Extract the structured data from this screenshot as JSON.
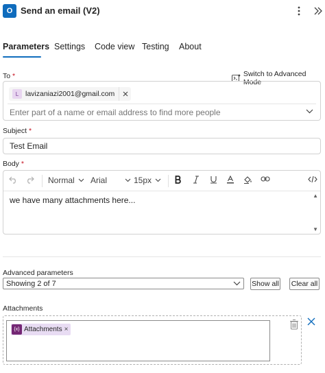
{
  "header": {
    "title": "Send an email (V2)",
    "app_icon_letter": "O"
  },
  "tabs": [
    {
      "label": "Parameters",
      "active": true
    },
    {
      "label": "Settings"
    },
    {
      "label": "Code view"
    },
    {
      "label": "Testing"
    },
    {
      "label": "About"
    }
  ],
  "to": {
    "label": "To",
    "required_mark": "*",
    "switch_label": "Switch to Advanced Mode",
    "chip_avatar": "L",
    "chip_email": "lavizaniazi2001@gmail.com",
    "placeholder": "Enter part of a name or email address to find more people"
  },
  "subject": {
    "label": "Subject",
    "required_mark": "*",
    "value": "Test Email"
  },
  "body": {
    "label": "Body",
    "required_mark": "*",
    "style": "Normal",
    "font": "Arial",
    "size": "15px",
    "content": "we have many attachments here..."
  },
  "advanced": {
    "label": "Advanced parameters",
    "showing": "Showing 2 of 7",
    "show_all": "Show all",
    "clear_all": "Clear all"
  },
  "attachments": {
    "label": "Attachments",
    "token_icon": "{x}",
    "token_label": "Attachments",
    "token_remove": "×"
  },
  "colors": {
    "accent": "#0f6cbd",
    "required": "#c50f1f",
    "token_bg": "#e8dcf3",
    "token_icon": "#742774"
  }
}
